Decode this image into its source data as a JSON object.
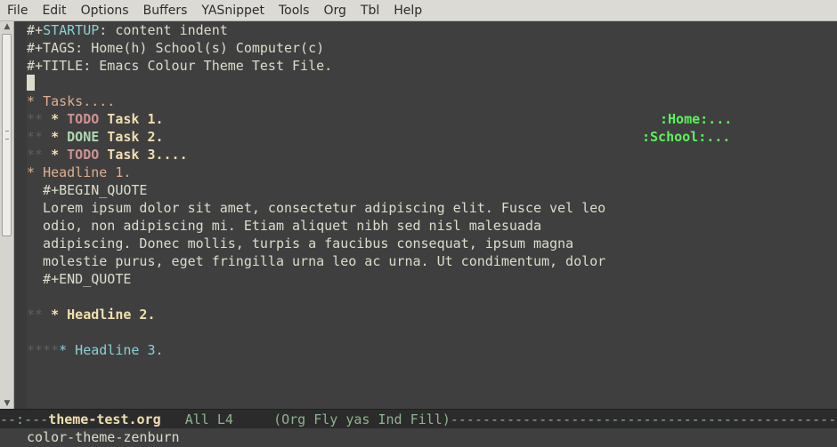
{
  "menubar": {
    "items": [
      "File",
      "Edit",
      "Options",
      "Buffers",
      "YASnippet",
      "Tools",
      "Org",
      "Tbl",
      "Help"
    ]
  },
  "buffer": {
    "l1": {
      "prefix": "#+",
      "keyword": "STARTUP",
      "rest": ": content indent"
    },
    "l2": {
      "text": "#+TAGS: Home(h) School(s) Computer(c)"
    },
    "l3": {
      "text": "#+TITLE: Emacs Colour Theme Test File."
    },
    "tasks_star": "* ",
    "tasks_text": "Tasks....",
    "task1": {
      "stars": "**",
      "star": " * ",
      "keyword": "TODO",
      "title": " Task 1.",
      "tag": ":Home:..."
    },
    "task2": {
      "stars": "**",
      "star": " * ",
      "keyword": "DONE",
      "title": " Task 2.",
      "tag": ":School:..."
    },
    "task3": {
      "stars": "**",
      "star": " * ",
      "keyword": "TODO",
      "title": " Task 3...."
    },
    "headline1_star": "* ",
    "headline1_text": "Headline 1.",
    "quote": [
      "  #+BEGIN_QUOTE",
      "  Lorem ipsum dolor sit amet, consectetur adipiscing elit. Fusce vel leo",
      "  odio, non adipiscing mi. Etiam aliquet nibh sed nisl malesuada",
      "  adipiscing. Donec mollis, turpis a faucibus consequat, ipsum magna",
      "  molestie purus, eget fringilla urna leo ac urna. Ut condimentum, dolor",
      "  #+END_QUOTE"
    ],
    "headline2": {
      "stars": "**",
      "text": " * Headline 2."
    },
    "headline3": {
      "stars": "****",
      "text": "* Headline 3."
    }
  },
  "modeline": {
    "prefix": "--:---",
    "buffer_name": "theme-test.org",
    "position": "   All L4     ",
    "modes": "(Org Fly yas Ind Fill)",
    "tail": "------------------------------------------------------------"
  },
  "minibuffer": {
    "text": "color-theme-zenburn"
  }
}
